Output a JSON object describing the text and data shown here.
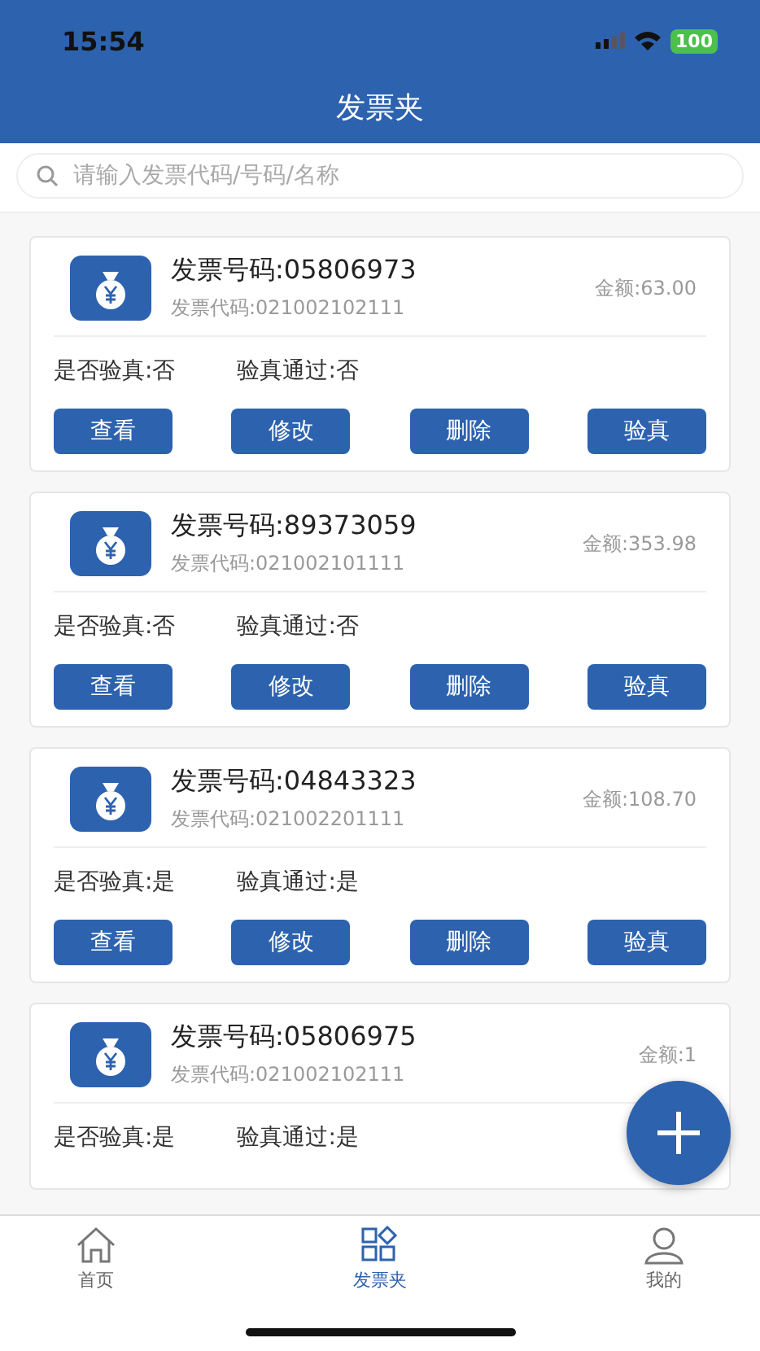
{
  "status_bar": {
    "time": "15:54",
    "battery": "100"
  },
  "header": {
    "title": "发票夹"
  },
  "search": {
    "placeholder": "请输入发票代码/号码/名称"
  },
  "invoices": [
    {
      "number": "发票号码:05806973",
      "code": "发票代码:021002102111",
      "amount": "金额:63.00",
      "verified": "是否验真:否",
      "passed": "验真通过:否",
      "buttons": [
        "查看",
        "修改",
        "删除",
        "验真"
      ]
    },
    {
      "number": "发票号码:89373059",
      "code": "发票代码:021002101111",
      "amount": "金额:353.98",
      "verified": "是否验真:否",
      "passed": "验真通过:否",
      "buttons": [
        "查看",
        "修改",
        "删除",
        "验真"
      ]
    },
    {
      "number": "发票号码:04843323",
      "code": "发票代码:021002201111",
      "amount": "金额:108.70",
      "verified": "是否验真:是",
      "passed": "验真通过:是",
      "buttons": [
        "查看",
        "修改",
        "删除",
        "验真"
      ]
    },
    {
      "number": "发票号码:05806975",
      "code": "发票代码:021002102111",
      "amount": "金额:1",
      "verified": "是否验真:是",
      "passed": "验真通过:是"
    }
  ],
  "tabs": [
    {
      "label": "首页",
      "kind": "home",
      "selected": false
    },
    {
      "label": "发票夹",
      "kind": "folder",
      "selected": true
    },
    {
      "label": "我的",
      "kind": "user",
      "selected": false
    }
  ]
}
